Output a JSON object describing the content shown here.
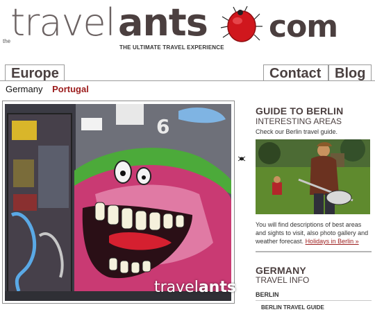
{
  "logo": {
    "the": "the",
    "travel": "travel",
    "ants": "ants",
    "com": "com",
    "tagline": "THE ULTIMATE TRAVEL EXPERIENCE"
  },
  "nav": {
    "tabs": [
      {
        "label": "Europe"
      },
      {
        "label": "Contact"
      },
      {
        "label": "Blog"
      }
    ]
  },
  "subnav": {
    "items": [
      {
        "label": "Germany"
      },
      {
        "label": "Portugal"
      }
    ]
  },
  "photo": {
    "watermark_travel": "travel",
    "watermark_ants": "ants"
  },
  "sidebar": {
    "guide": {
      "title": "GUIDE TO BERLIN",
      "subtitle": "INTERESTING AREAS",
      "description": "Check our Berlin travel guide.",
      "body": "You will find descriptions of best areas and sights to visit, also photo gallery and weather forecast.",
      "link": "Holidays in Berlin »"
    },
    "germany": {
      "title": "GERMANY",
      "subtitle": "TRAVEL INFO",
      "link": "BERLIN",
      "sublink": "BERLIN TRAVEL GUIDE"
    }
  },
  "colors": {
    "brand_dark": "#4b3f3f",
    "brand_light": "#6b6262",
    "accent_red": "#9b1b1b",
    "ant_red": "#d0171d"
  }
}
